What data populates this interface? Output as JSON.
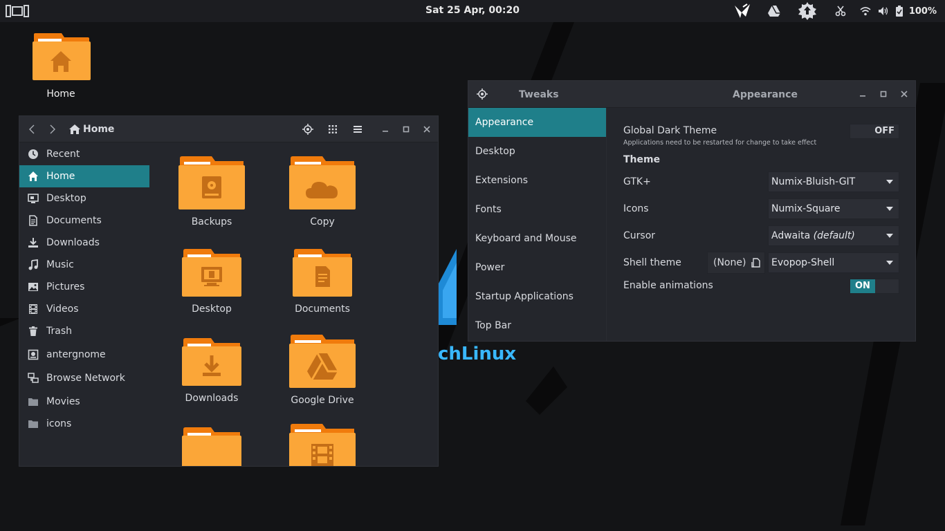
{
  "topbar": {
    "clock": "Sat 25 Apr, 00:20",
    "battery": "100%",
    "icons": [
      "activities-icon",
      "shutter-icon",
      "drive-icon",
      "update-icon",
      "scissors-icon",
      "wifi-icon",
      "volume-icon",
      "battery-icon"
    ]
  },
  "desktop": {
    "home_label": "Home",
    "wallpaper_text": "chLinux"
  },
  "files": {
    "breadcrumb": "Home",
    "sidebar": [
      {
        "label": "Recent",
        "icon": "clock-icon"
      },
      {
        "label": "Home",
        "icon": "home-icon",
        "active": true
      },
      {
        "label": "Desktop",
        "icon": "desktop-icon"
      },
      {
        "label": "Documents",
        "icon": "document-icon"
      },
      {
        "label": "Downloads",
        "icon": "download-icon"
      },
      {
        "label": "Music",
        "icon": "music-icon"
      },
      {
        "label": "Pictures",
        "icon": "picture-icon"
      },
      {
        "label": "Videos",
        "icon": "video-icon"
      },
      {
        "label": "Trash",
        "icon": "trash-icon"
      },
      {
        "label": "antergnome",
        "icon": "drive-icon"
      },
      {
        "label": "Browse Network",
        "icon": "network-icon"
      },
      {
        "label": "Movies",
        "icon": "folder-icon"
      },
      {
        "label": "icons",
        "icon": "folder-icon"
      }
    ],
    "folders": [
      {
        "label": "Backups",
        "icon": "backup-icon"
      },
      {
        "label": "Copy",
        "icon": "cloud-icon"
      },
      {
        "label": "Desktop",
        "icon": "desktop-icon"
      },
      {
        "label": "Documents",
        "icon": "document-icon"
      },
      {
        "label": "Downloads",
        "icon": "download-icon"
      },
      {
        "label": "Google Drive",
        "icon": "google-drive-icon"
      },
      {
        "label": "",
        "icon": "folder-icon"
      },
      {
        "label": "",
        "icon": "film-icon"
      }
    ]
  },
  "tweaks": {
    "app_title": "Tweaks",
    "page_title": "Appearance",
    "sidebar": [
      "Appearance",
      "Desktop",
      "Extensions",
      "Fonts",
      "Keyboard and Mouse",
      "Power",
      "Startup Applications",
      "Top Bar"
    ],
    "global_dark_label": "Global Dark Theme",
    "global_dark_hint": "Applications need to be restarted for change to take effect",
    "global_dark_state": "OFF",
    "theme_header": "Theme",
    "gtk_label": "GTK+",
    "gtk_value": "Numix-Bluish-GIT",
    "icons_label": "Icons",
    "icons_value": "Numix-Square",
    "cursor_label": "Cursor",
    "cursor_value": "Adwaita",
    "cursor_suffix": "(default)",
    "shell_label": "Shell theme",
    "shell_file": "(None)",
    "shell_value": "Evopop-Shell",
    "anim_label": "Enable animations",
    "anim_state": "ON"
  },
  "colors": {
    "accent": "#1f7f8a",
    "folder": "#fba638",
    "folder_tab": "#f07b0c"
  }
}
